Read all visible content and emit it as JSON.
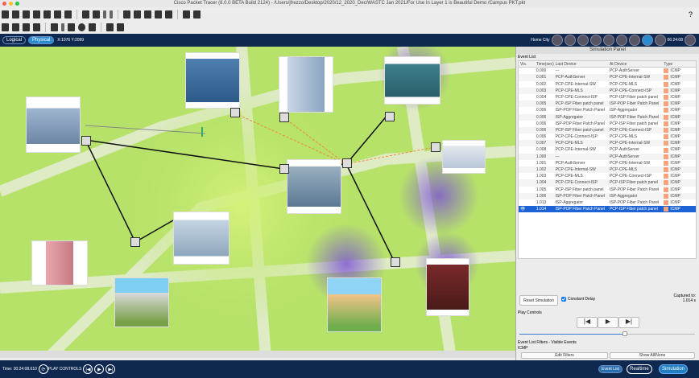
{
  "title": "Cisco Packet Tracer (8.0.0 BETA Build 2124) - /Users/jfrezzo/Desktop/2020/12_2020_Dec/WASTC Jan 2021/For Use In Layer 1 is Beautiful Demo /Campus PKT.pkt",
  "nav": {
    "logical": "Logical",
    "physical": "Physical",
    "coords": "X:1076 Y:2099",
    "home_city": "Home City",
    "clock": "06:24:08"
  },
  "panel": {
    "title": "Simulation Panel",
    "event_list_label": "Event List",
    "columns": [
      "Vis.",
      "Time(sec)",
      "Last Device",
      "At Device",
      "Type"
    ],
    "icmp_color": "#f4a57e",
    "events": [
      {
        "time": "0.000",
        "last": "---",
        "at": "PCP-AuthServer",
        "type": "ICMP"
      },
      {
        "time": "0.001",
        "last": "PCP-AuthServer",
        "at": "PCP-CPE-Internal-SW",
        "type": "ICMP"
      },
      {
        "time": "0.002",
        "last": "PCP-CPE-Internal-SW",
        "at": "PCP-CPE-MLS",
        "type": "ICMP"
      },
      {
        "time": "0.003",
        "last": "PCP-CPE-MLS",
        "at": "PCP-CPE-Connect-ISP",
        "type": "ICMP"
      },
      {
        "time": "0.004",
        "last": "PCP-CPE-Connect-ISP",
        "at": "PCP-ISP Fiber patch panel",
        "type": "ICMP"
      },
      {
        "time": "0.005",
        "last": "PCP-ISP Fiber patch panel",
        "at": "ISP-POP Fiber Patch Panel",
        "type": "ICMP"
      },
      {
        "time": "0.006",
        "last": "ISP-POP Fiber Patch Panel",
        "at": "ISP-Aggregator",
        "type": "ICMP"
      },
      {
        "time": "0.006",
        "last": "ISP-Aggregator",
        "at": "ISP-POP Fiber Patch Panel",
        "type": "ICMP"
      },
      {
        "time": "0.006",
        "last": "ISP-POP Fiber Patch Panel",
        "at": "PCP-ISP Fiber patch panel",
        "type": "ICMP"
      },
      {
        "time": "0.006",
        "last": "PCP-ISP Fiber patch panel",
        "at": "PCP-CPE-Connect-ISP",
        "type": "ICMP"
      },
      {
        "time": "0.006",
        "last": "PCP-CPE-Connect-ISP",
        "at": "PCP-CPE-MLS",
        "type": "ICMP"
      },
      {
        "time": "0.007",
        "last": "PCP-CPE-MLS",
        "at": "PCP-CPE-Internal-SW",
        "type": "ICMP"
      },
      {
        "time": "0.008",
        "last": "PCP-CPE-Internal-SW",
        "at": "PCP-AuthServer",
        "type": "ICMP"
      },
      {
        "time": "1.000",
        "last": "---",
        "at": "PCP-AuthServer",
        "type": "ICMP"
      },
      {
        "time": "1.001",
        "last": "PCP-AuthServer",
        "at": "PCP-CPE-Internal-SW",
        "type": "ICMP"
      },
      {
        "time": "1.002",
        "last": "PCP-CPE-Internal-SW",
        "at": "PCP-CPE-MLS",
        "type": "ICMP"
      },
      {
        "time": "1.003",
        "last": "PCP-CPE-MLS",
        "at": "PCP-CPE-Connect-ISP",
        "type": "ICMP"
      },
      {
        "time": "1.004",
        "last": "PCP-CPE-Connect-ISP",
        "at": "PCP-ISP Fiber patch panel",
        "type": "ICMP"
      },
      {
        "time": "1.005",
        "last": "PCP-ISP Fiber patch panel",
        "at": "ISP-POP Fiber Patch Panel",
        "type": "ICMP"
      },
      {
        "time": "1.006",
        "last": "ISP-POP Fiber Patch Panel",
        "at": "ISP-Aggregator",
        "type": "ICMP"
      },
      {
        "time": "1.013",
        "last": "ISP-Aggregator",
        "at": "ISP-POP Fiber Patch Panel",
        "type": "ICMP"
      },
      {
        "time": "1.014",
        "last": "ISP-POP Fiber Patch Panel",
        "at": "PCP-ISP Fiber patch panel",
        "type": "ICMP",
        "selected": true
      }
    ],
    "reset": "Reset Simulation",
    "constant_delay": "Constant Delay",
    "captured_label": "Captured to:",
    "captured_value": "1.014 s",
    "play_controls": "Play Controls",
    "speed": 0.6,
    "filters_label": "Event List Filters - Visible Events",
    "filters_value": "ICMP",
    "edit_filters": "Edit Filters",
    "show_all": "Show All/None"
  },
  "bottom": {
    "time": "Time: 00:24:08.610",
    "play_controls": "PLAY CONTROLS",
    "event_list": "Event List",
    "realtime": "Realtime",
    "simulation": "Simulation"
  }
}
